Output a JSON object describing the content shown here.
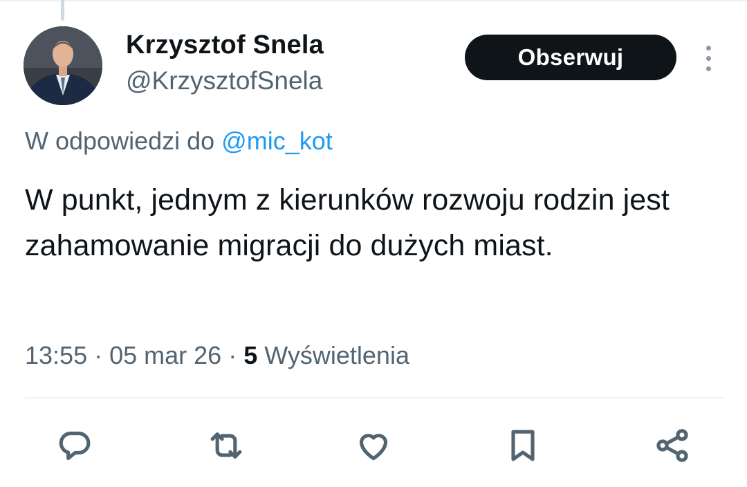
{
  "author": {
    "name": "Krzysztof Snela",
    "handle": "@KrzysztofSnela"
  },
  "header": {
    "follow_label": "Obserwuj"
  },
  "reply": {
    "prefix": "W odpowiedzi do ",
    "mention": "@mic_kot"
  },
  "tweet": {
    "text": "W punkt, jednym z kierunków rozwoju rodzin jest zahamowanie migracji do dużych miast."
  },
  "meta": {
    "time": "13:55",
    "separator": " · ",
    "date": "05 mar 26",
    "views_count": "5",
    "views_label": " Wyświetlenia"
  },
  "icons": {
    "reply": "reply-icon",
    "retweet": "retweet-icon",
    "like": "heart-icon",
    "bookmark": "bookmark-icon",
    "share": "share-icon",
    "more": "more-vertical-icon"
  },
  "colors": {
    "text_primary": "#0f1419",
    "text_secondary": "#536471",
    "link": "#1d9bf0",
    "button_bg": "#0f1419",
    "button_text": "#ffffff"
  }
}
